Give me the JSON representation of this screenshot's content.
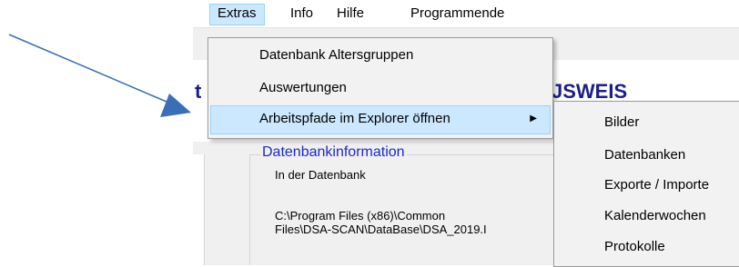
{
  "menubar": {
    "items": [
      "Extras",
      "Info",
      "Hilfe",
      "Programmende"
    ]
  },
  "background": {
    "title_fragment_left": "t",
    "title_fragment_right": "JSWEIS",
    "info_heading": "Datenbankinformation",
    "line1": "In der Datenbank",
    "path_line1": "C:\\Program Files (x86)\\Common",
    "path_line2": "Files\\DSA-SCAN\\DataBase\\DSA_2019.I"
  },
  "extras_menu": {
    "items": [
      "Datenbank Altersgruppen",
      "Auswertungen",
      "Arbeitspfade im Explorer öffnen"
    ],
    "submenu_arrow": "▶"
  },
  "submenu": {
    "items": [
      "Bilder",
      "Datenbanken",
      "Exporte / Importe",
      "Kalenderwochen",
      "Protokolle"
    ]
  },
  "colors": {
    "highlight": "#cce8ff",
    "arrow": "#3a6fb8",
    "title": "#1b1f8a",
    "info_heading": "#1a29d0"
  }
}
